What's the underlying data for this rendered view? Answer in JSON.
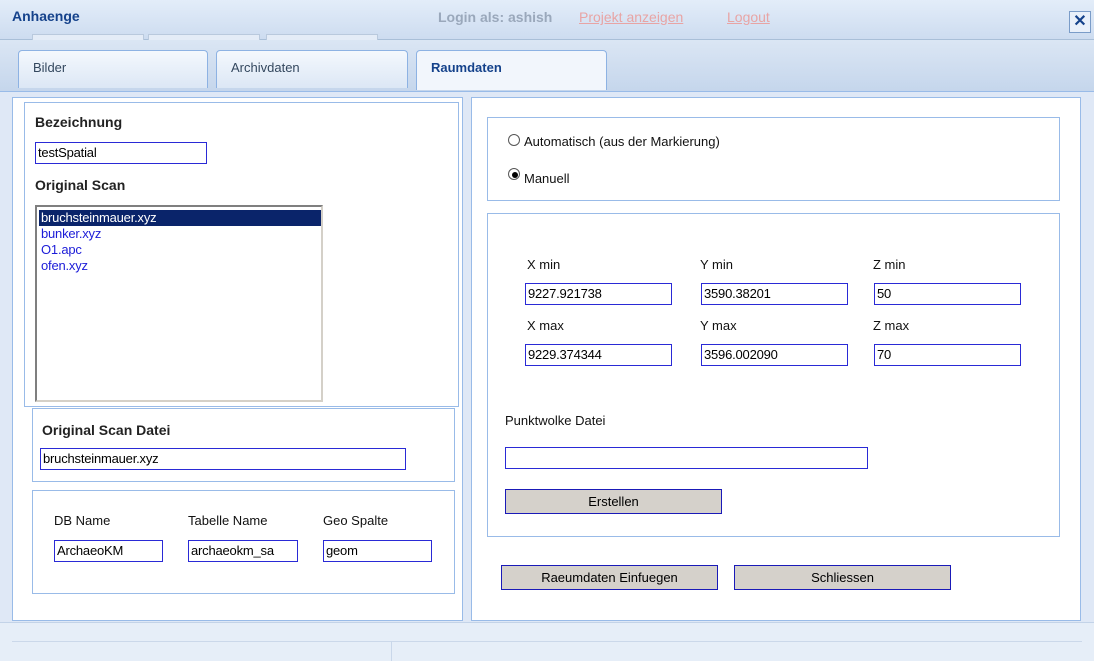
{
  "window": {
    "title": "Anhaenge",
    "login_text": "Login als: ashish",
    "link_projekt": "Projekt anzeigen",
    "link_logout": "Logout",
    "close_glyph": "✕"
  },
  "tabs": [
    {
      "label": "Bilder",
      "active": false
    },
    {
      "label": "Archivdaten",
      "active": false
    },
    {
      "label": "Raumdaten",
      "active": true
    }
  ],
  "left": {
    "bezeichnung_label": "Bezeichnung",
    "bezeichnung_value": "testSpatial",
    "original_scan_label": "Original Scan",
    "scan_list": [
      {
        "text": "bruchsteinmauer.xyz",
        "selected": true
      },
      {
        "text": "bunker.xyz",
        "selected": false
      },
      {
        "text": "O1.apc",
        "selected": false
      },
      {
        "text": "ofen.xyz",
        "selected": false
      }
    ],
    "scan_datei_label": "Original Scan Datei",
    "scan_datei_value": "bruchsteinmauer.xyz",
    "db_name_label": "DB Name",
    "db_name_value": "ArchaeoKM",
    "tabelle_label": "Tabelle Name",
    "tabelle_value": "archaeokm_sa",
    "geo_spalte_label": "Geo Spalte",
    "geo_spalte_value": "geom"
  },
  "right": {
    "radio_auto_label": "Automatisch (aus der Markierung)",
    "radio_auto_checked": false,
    "radio_manuell_label": "Manuell",
    "radio_manuell_checked": true,
    "coords": {
      "xmin_label": "X min",
      "xmin_value": "9227.921738",
      "ymin_label": "Y min",
      "ymin_value": "3590.38201",
      "zmin_label": "Z min",
      "zmin_value": "50",
      "xmax_label": "X max",
      "xmax_value": "9229.374344",
      "ymax_label": "Y max",
      "ymax_value": "3596.002090",
      "zmax_label": "Z max",
      "zmax_value": "70"
    },
    "punktwolke_label": "Punktwolke Datei",
    "punktwolke_value": "",
    "erstellen_label": "Erstellen",
    "einfuegen_label": "Raeumdaten Einfuegen",
    "schliessen_label": "Schliessen"
  }
}
